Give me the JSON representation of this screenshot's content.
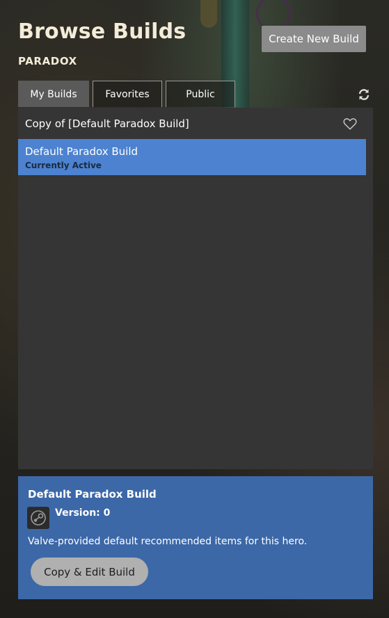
{
  "header": {
    "title": "Browse Builds",
    "hero": "PARADOX",
    "create_label": "Create New Build"
  },
  "tabs": [
    {
      "label": "My Builds",
      "active": true
    },
    {
      "label": "Favorites",
      "active": false
    },
    {
      "label": "Public",
      "active": false
    }
  ],
  "icons": {
    "refresh": "refresh-icon",
    "favorite": "heart-outline-icon",
    "source": "steam-icon"
  },
  "list": {
    "items": [
      {
        "name": "Copy of [Default Paradox Build]",
        "status": ""
      },
      {
        "name": "Default Paradox Build",
        "status": "Currently Active"
      }
    ]
  },
  "details": {
    "title": "Default Paradox Build",
    "version": "Version: 0",
    "description": "Valve-provided default recommended items for this hero.",
    "copy_label": "Copy & Edit Build"
  },
  "colors": {
    "selected_row": "#4c82d0",
    "details_panel": "#3c68a8",
    "list_bg": "#353535",
    "title_text": "#f4ecd8"
  }
}
